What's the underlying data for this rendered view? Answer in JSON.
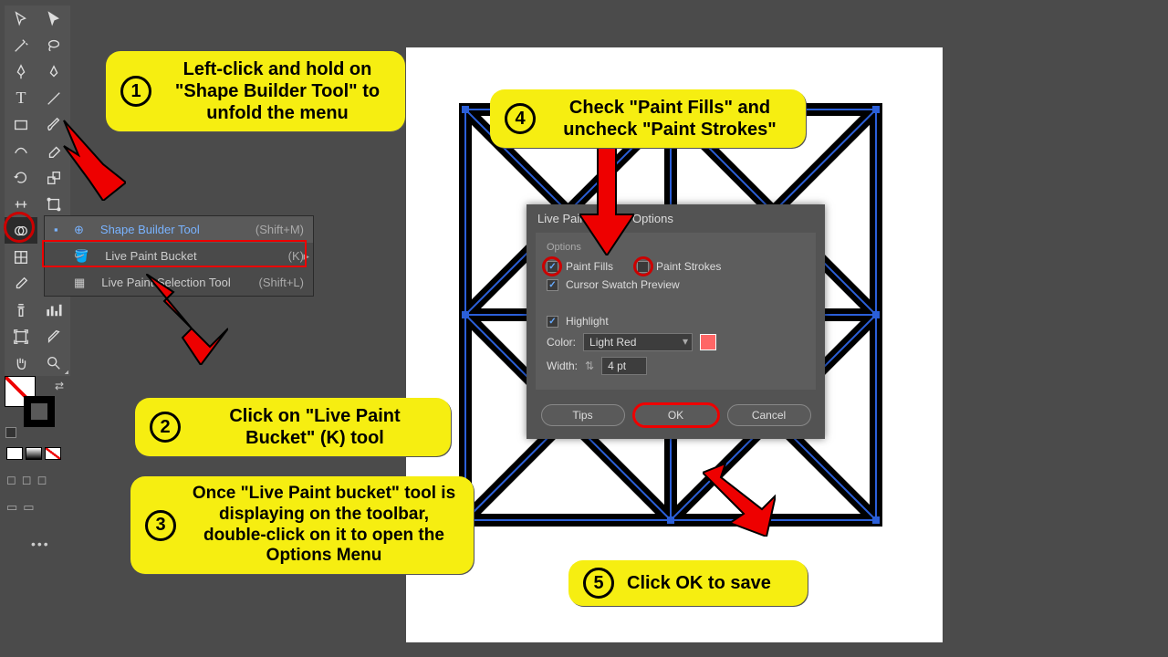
{
  "flyout": {
    "items": [
      {
        "label": "Shape Builder Tool",
        "shortcut": "(Shift+M)"
      },
      {
        "label": "Live Paint Bucket",
        "shortcut": "(K)"
      },
      {
        "label": "Live Paint Selection Tool",
        "shortcut": "(Shift+L)"
      }
    ]
  },
  "callouts": {
    "c1": "Left-click and hold on \"Shape Builder Tool\" to unfold the menu",
    "c2": "Click on \"Live Paint Bucket\" (K) tool",
    "c3": "Once \"Live Paint bucket\" tool is displaying on the toolbar, double-click on it to open the Options Menu",
    "c4": "Check \"Paint Fills\" and uncheck \"Paint Strokes\"",
    "c5": "Click OK to save"
  },
  "dialog": {
    "title": "Live Paint Bucket Options",
    "section": "Options",
    "paint_fills": "Paint Fills",
    "paint_strokes": "Paint Strokes",
    "cursor_swatch": "Cursor Swatch Preview",
    "highlight": "Highlight",
    "color_label": "Color:",
    "color_value": "Light Red",
    "width_label": "Width:",
    "width_value": "4 pt",
    "tips": "Tips",
    "ok": "OK",
    "cancel": "Cancel"
  },
  "nums": {
    "n1": "1",
    "n2": "2",
    "n3": "3",
    "n4": "4",
    "n5": "5"
  }
}
